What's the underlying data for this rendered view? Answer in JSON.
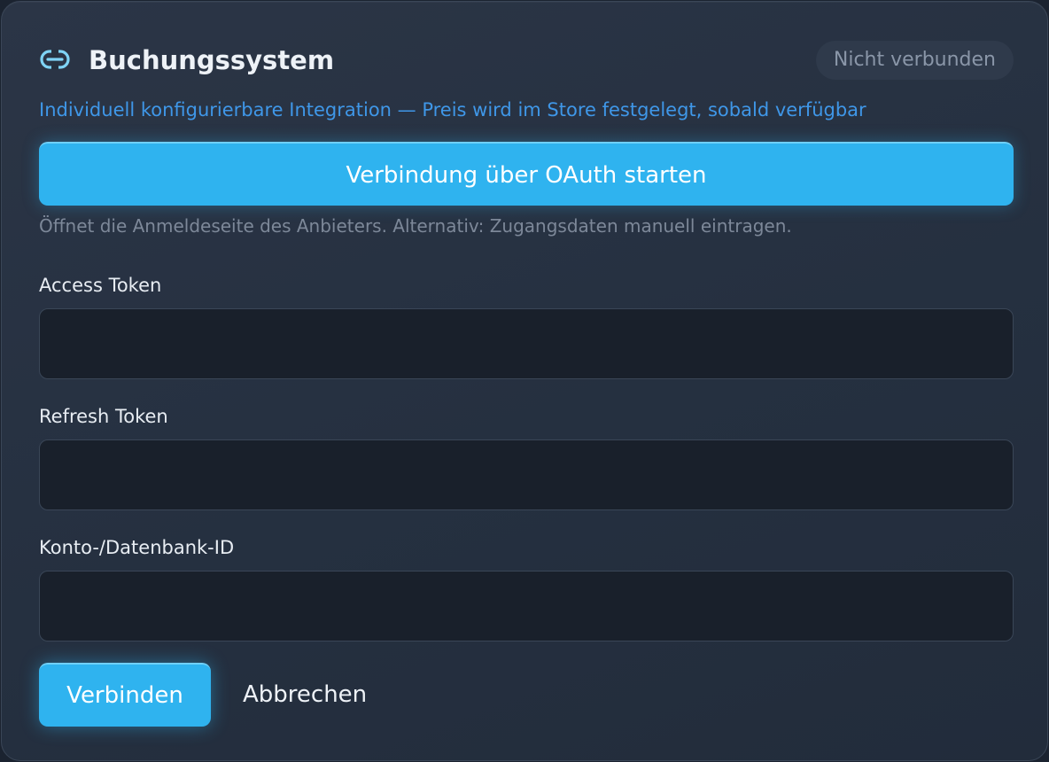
{
  "header": {
    "icon": "link-icon",
    "title": "Buchungssystem",
    "status": "Nicht verbunden"
  },
  "subtitle": "Individuell konfigurierbare Integration — Preis wird im Store festgelegt, sobald verfügbar",
  "oauth": {
    "button_label": "Verbindung über OAuth starten",
    "helper_text": "Öffnet die Anmeldeseite des Anbieters. Alternativ: Zugangsdaten manuell eintragen."
  },
  "fields": [
    {
      "label": "Access Token",
      "value": "",
      "placeholder": ""
    },
    {
      "label": "Refresh Token",
      "value": "",
      "placeholder": ""
    },
    {
      "label": "Konto-/Datenbank-ID",
      "value": "",
      "placeholder": ""
    }
  ],
  "actions": {
    "connect_label": "Verbinden",
    "cancel_label": "Abbrechen"
  },
  "colors": {
    "accent": "#2fb3ef",
    "link_text": "#3f97e8",
    "card_background": "#27303f",
    "input_background": "#19202b"
  }
}
